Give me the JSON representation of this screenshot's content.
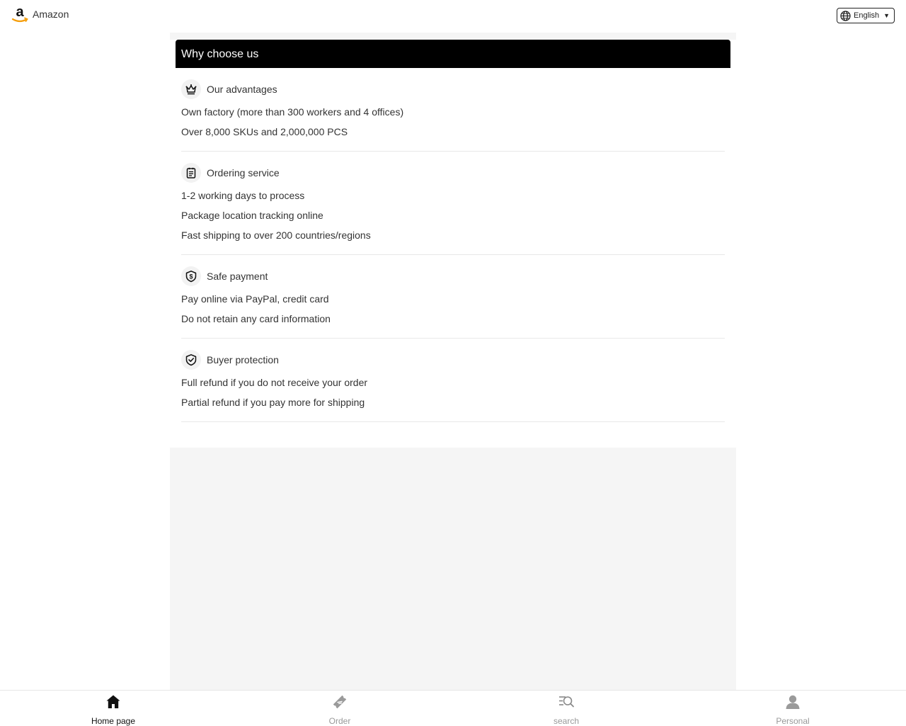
{
  "header": {
    "brand_name": "Amazon",
    "language": "English"
  },
  "panel": {
    "title": "Why choose us",
    "sections": [
      {
        "icon": "crown-icon",
        "title": "Our advantages",
        "lines": [
          "Own factory (more than 300 workers and 4 offices)",
          "Over 8,000 SKUs and 2,000,000 PCS"
        ]
      },
      {
        "icon": "clipboard-icon",
        "title": "Ordering service",
        "lines": [
          "1-2 working days to process",
          "Package location tracking online",
          "Fast shipping to over 200 countries/regions"
        ]
      },
      {
        "icon": "shield-dollar-icon",
        "title": "Safe payment",
        "lines": [
          "Pay online via PayPal, credit card",
          "Do not retain any card information"
        ]
      },
      {
        "icon": "shield-check-icon",
        "title": "Buyer protection",
        "lines": [
          "Full refund if you do not receive your order",
          "Partial refund if you pay more for shipping"
        ]
      }
    ]
  },
  "tabbar": {
    "items": [
      {
        "label": "Home page",
        "icon": "home-icon",
        "active": true
      },
      {
        "label": "Order",
        "icon": "ticket-icon",
        "active": false
      },
      {
        "label": "search",
        "icon": "search-icon",
        "active": false
      },
      {
        "label": "Personal",
        "icon": "person-icon",
        "active": false
      }
    ]
  },
  "colors": {
    "header_bg": "#000000",
    "page_bg": "#f5f5f5",
    "active_tab": "#111111",
    "inactive_tab": "#999999",
    "brand_smile": "#f59e0b"
  }
}
